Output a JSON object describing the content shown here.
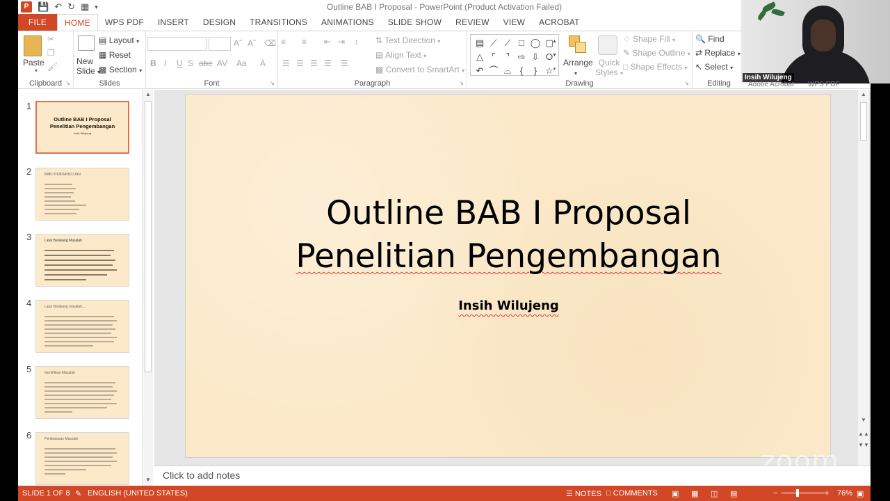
{
  "window": {
    "title": "Outline BAB I Proposal - PowerPoint (Product Activation Failed)",
    "app_icon": "P"
  },
  "tabs": [
    "FILE",
    "HOME",
    "WPS PDF",
    "INSERT",
    "DESIGN",
    "TRANSITIONS",
    "ANIMATIONS",
    "SLIDE SHOW",
    "REVIEW",
    "VIEW",
    "ACROBAT"
  ],
  "active_tab": "HOME",
  "ribbon": {
    "clipboard": {
      "label": "Clipboard",
      "paste": "Paste"
    },
    "slides": {
      "label": "Slides",
      "new_slide_line1": "New",
      "new_slide_line2": "Slide",
      "layout": "Layout",
      "reset": "Reset",
      "section": "Section"
    },
    "font": {
      "label": "Font",
      "bold": "B",
      "italic": "I",
      "underline": "U",
      "strike": "S",
      "shadow": "abc",
      "spacing": "AV",
      "case": "Aa",
      "color": "A"
    },
    "paragraph": {
      "label": "Paragraph",
      "text_direction": "Text Direction",
      "align_text": "Align Text",
      "convert_smartart": "Convert to SmartArt"
    },
    "drawing": {
      "label": "Drawing",
      "arrange": "Arrange",
      "quick_styles_line1": "Quick",
      "quick_styles_line2": "Styles",
      "shape_fill": "Shape Fill",
      "shape_outline": "Shape Outline",
      "shape_effects": "Shape Effects"
    },
    "editing": {
      "label": "Editing",
      "find": "Find",
      "replace": "Replace",
      "select": "Select"
    }
  },
  "thumbnails": [
    {
      "num": "1",
      "title_line1": "Outline BAB I Proposal",
      "title_line2": "Penelitian Pengembangan",
      "sub": "Insih Wilujeng"
    },
    {
      "num": "2",
      "title": "BAB I PENDAHULUAN"
    },
    {
      "num": "3",
      "title": "Latar Belakang Masalah"
    },
    {
      "num": "4",
      "title": "Latar Belakang masalah...."
    },
    {
      "num": "5",
      "title": "Identifikasi Masalah"
    },
    {
      "num": "6",
      "title": "Pembatasan Masalah"
    }
  ],
  "slide": {
    "title_line1": "Outline BAB I Proposal",
    "title_line2": "Penelitian Pengembangan",
    "subtitle": "Insih Wilujeng"
  },
  "notes_placeholder": "Click to add notes",
  "status": {
    "slide_of": "SLIDE 1 OF 8",
    "language": "ENGLISH (UNITED STATES)",
    "notes": "NOTES",
    "comments": "COMMENTS",
    "zoom": "76%",
    "zoom_fraction": 0.76
  },
  "webcam": {
    "participant_name": "Insih Wilujeng",
    "hidden_tab_1": "Adobe Acrobat",
    "hidden_tab_2": "WPS PDF"
  },
  "watermark": "zoom",
  "colors": {
    "accent": "#d24726",
    "slide_bg": "#fbe9c9"
  }
}
